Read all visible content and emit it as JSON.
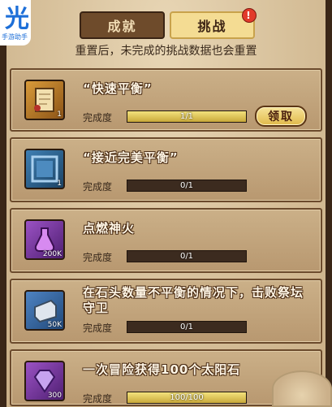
{
  "tabs": [
    {
      "label": "成就",
      "active": false
    },
    {
      "label": "挑战",
      "active": true,
      "badge": "!"
    }
  ],
  "notice": "重置后，未完成的挑战数据也会重置",
  "corner_badge": {
    "glyph": "光",
    "text": "手游助手"
  },
  "progress_label": "完成度",
  "claim_label": "领取",
  "challenges": [
    {
      "title": "“快速平衡”",
      "icon": "scroll-icon",
      "icon_count": "1",
      "progress_text": "1/1",
      "progress": 1.0,
      "claimable": true
    },
    {
      "title": "“接近完美平衡”",
      "icon": "frame-icon",
      "icon_count": "1",
      "progress_text": "0/1",
      "progress": 0.0,
      "claimable": false
    },
    {
      "title": "点燃神火",
      "icon": "potion-icon",
      "icon_count": "200K",
      "progress_text": "0/1",
      "progress": 0.0,
      "claimable": false
    },
    {
      "title": "在石头数量不平衡的情况下，击败祭坛守卫",
      "icon": "stone-icon",
      "icon_count": "50K",
      "progress_text": "0/1",
      "progress": 0.0,
      "claimable": false
    },
    {
      "title": "一次冒险获得100个太阳石",
      "icon": "gem-icon",
      "icon_count": "300",
      "progress_text": "100/100",
      "progress": 1.0,
      "claimable": false
    }
  ],
  "colors": {
    "accent": "#f4dc93",
    "bar_fill": "#e2c85a",
    "bar_bg": "#3c2b1f"
  }
}
